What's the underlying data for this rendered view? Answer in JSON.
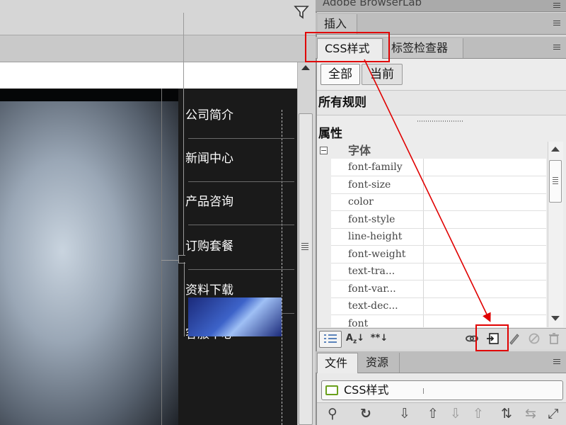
{
  "document": {
    "nav_items": [
      "公司简介",
      "新闻中心",
      "产品咨询",
      "订购套餐",
      "资料下载",
      "客服中心"
    ]
  },
  "panel": {
    "browserlab_title": "Adobe BrowserLab",
    "insert_tab": "插入",
    "css_tabs": [
      "CSS样式",
      "标签检查器"
    ],
    "mode_buttons": {
      "all": "全部",
      "current": "当前",
      "selected": "all"
    },
    "rules_header": "所有规则",
    "properties_header": "属性",
    "group": {
      "collapse_symbol": "⊟",
      "label": "字体"
    },
    "properties": [
      "font-family",
      "font-size",
      "color",
      "font-style",
      "line-height",
      "font-weight",
      "text-tra...",
      "font-var...",
      "text-dec...",
      "font"
    ]
  },
  "files": {
    "tabs": [
      "文件",
      "资源"
    ],
    "site": "CSS样式"
  },
  "icons": {
    "filter": "filter-icon",
    "category_view": "category-view-icon",
    "alpha_view": "alpha-sort-icon",
    "set_props": "set-properties-icon",
    "attach": "attach-style-sheet-icon",
    "new_rule": "new-css-rule-icon",
    "edit": "edit-rule-icon",
    "disable": "disable-icon",
    "delete": "delete-icon"
  },
  "colors": {
    "highlight": "#e00000",
    "canvas_bg": "#1a1a1a",
    "panel_bg": "#d9d9d9"
  }
}
